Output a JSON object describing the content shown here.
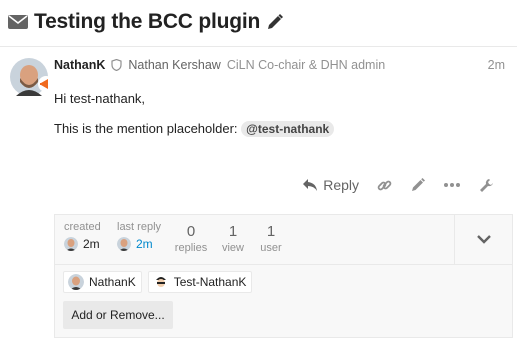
{
  "topic": {
    "title": "Testing the BCC plugin"
  },
  "post": {
    "username": "NathanK",
    "full_name": "Nathan Kershaw",
    "user_title": "CiLN Co-chair & DHN admin",
    "post_date": "2m",
    "body_line1": "Hi test-nathank,",
    "body_line2": "This is the mention placeholder:",
    "mention": "@test-nathank"
  },
  "actions": {
    "reply_label": "Reply"
  },
  "summary": {
    "created_label": "created",
    "created_value": "2m",
    "last_reply_label": "last reply",
    "last_reply_value": "2m",
    "replies_count": "0",
    "replies_label": "replies",
    "views_count": "1",
    "views_label": "view",
    "users_count": "1",
    "users_label": "user"
  },
  "participants": [
    {
      "name": "NathanK"
    },
    {
      "name": "Test-NathanK"
    }
  ],
  "add_button_label": "Add or Remove...",
  "colors": {
    "text": "#222222",
    "muted": "#919191",
    "link": "#0088cc",
    "summary_bg": "#f8f8f8",
    "border": "#e9e9e9"
  }
}
